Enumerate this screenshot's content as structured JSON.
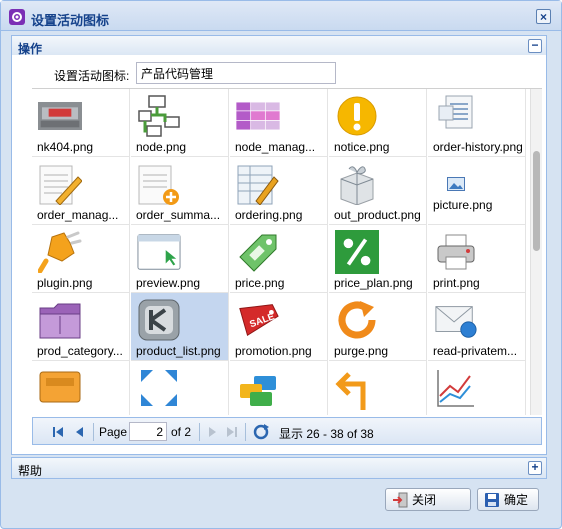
{
  "window": {
    "title": "设置活动图标"
  },
  "panel": {
    "title": "操作"
  },
  "field": {
    "label": "设置活动图标:",
    "value": "产品代码管理"
  },
  "grid": {
    "items": [
      {
        "name": "nk404.png",
        "icon": "photo-404-icon"
      },
      {
        "name": "node.png",
        "icon": "node-tree-icon"
      },
      {
        "name": "node_manag...",
        "icon": "node-manager-icon"
      },
      {
        "name": "notice.png",
        "icon": "notice-icon"
      },
      {
        "name": "order-history.png",
        "icon": "order-history-icon"
      },
      {
        "name": "order_manag...",
        "icon": "order-manager-icon"
      },
      {
        "name": "order_summa...",
        "icon": "order-summary-icon"
      },
      {
        "name": "ordering.png",
        "icon": "ordering-icon"
      },
      {
        "name": "out_product.png",
        "icon": "gift-box-icon"
      },
      {
        "name": "picture.png",
        "icon": "picture-icon"
      },
      {
        "name": "plugin.png",
        "icon": "plugin-icon"
      },
      {
        "name": "preview.png",
        "icon": "preview-window-icon"
      },
      {
        "name": "price.png",
        "icon": "price-tag-icon"
      },
      {
        "name": "price_plan.png",
        "icon": "percent-icon"
      },
      {
        "name": "print.png",
        "icon": "printer-icon"
      },
      {
        "name": "prod_category...",
        "icon": "folder-icon"
      },
      {
        "name": "product_list.png",
        "icon": "product-list-icon"
      },
      {
        "name": "promotion.png",
        "icon": "sale-tag-icon"
      },
      {
        "name": "purge.png",
        "icon": "purge-refresh-icon"
      },
      {
        "name": "read-privatem...",
        "icon": "mail-icon"
      },
      {
        "name": "",
        "icon": "inbox-icon"
      },
      {
        "name": "",
        "icon": "expand-arrows-icon"
      },
      {
        "name": "",
        "icon": "stacked-cards-icon"
      },
      {
        "name": "",
        "icon": "return-arrow-icon"
      },
      {
        "name": "",
        "icon": "chart-icon"
      }
    ]
  },
  "pager": {
    "page_label": "Page",
    "page_value": "2",
    "of_label": "of 2",
    "display_text": "显示 26 - 38 of 38"
  },
  "help": {
    "title": "帮助"
  },
  "buttons": {
    "close": "关闭",
    "ok": "确定"
  }
}
